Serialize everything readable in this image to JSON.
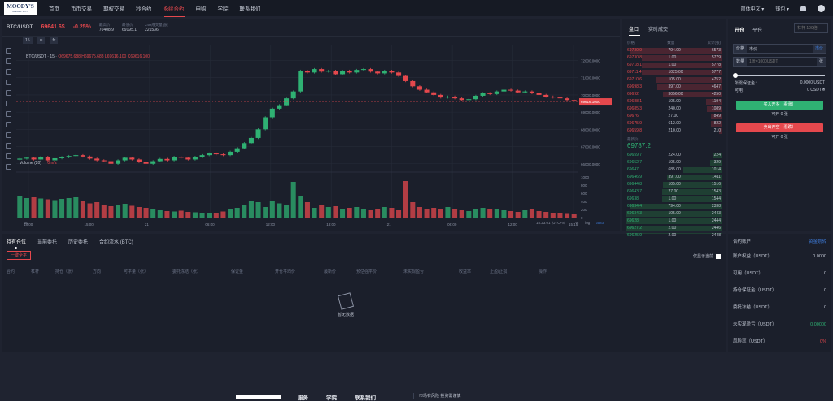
{
  "logo": {
    "line1": "MOODY'S",
    "line2": "ANALYTICS"
  },
  "nav": {
    "items": [
      "首页",
      "币币交易",
      "期权交易",
      "秒合约",
      "永续合约",
      "申购",
      "学院",
      "联系我们"
    ],
    "active_index": 4,
    "language": "简体中文 ▾",
    "wallet": "钱包 ▾"
  },
  "ticker": {
    "symbol": "BTC/USDT",
    "price": "69641.6$",
    "change": "-0.25%",
    "stats": [
      {
        "label": "最高价",
        "value": "70408.9"
      },
      {
        "label": "最低价",
        "value": "69195.1"
      },
      {
        "label": "24H成交量(张)",
        "value": "221536"
      }
    ]
  },
  "chart_toolbar": {
    "interval": "15",
    "candles_label": "ılı",
    "indicators": "fx"
  },
  "chart_legend": {
    "pair": "BTC/USDT · 15 ·",
    "ohlc": "O69675.688 H69675.688 L69616.100 C69616.100"
  },
  "volume_legend": {
    "label": "Volume (20)",
    "value": "0 n/a"
  },
  "time_bar": {
    "range_label": "5d",
    "clock": "15:23:01 (UTC+8)",
    "scale": "%",
    "log": "log",
    "auto": "auto"
  },
  "chart_data": {
    "type": "candlestick",
    "price_axis": [
      "72000.0000",
      "71000.0000",
      "70000.0000",
      "69000.0000",
      "68000.0000",
      "67000.0000",
      "66000.0000"
    ],
    "volume_axis": [
      "1000",
      "800",
      "600",
      "400",
      "200",
      "0"
    ],
    "time_axis": [
      "18:00",
      "15:00",
      "21",
      "06:00",
      "12:00",
      "18:00",
      "21",
      "06:00",
      "12:00",
      "15:15"
    ],
    "last_price_tag": "69616.1000",
    "ylim": [
      65800,
      72400
    ],
    "series": [
      66300,
      66350,
      66250,
      66400,
      66200,
      66320,
      66380,
      66450,
      66500,
      66420,
      66300,
      66200,
      66150,
      66000,
      66200,
      66350,
      66250,
      66100,
      66000,
      66150,
      66280,
      66200,
      66400,
      66350,
      66250,
      66400,
      66500,
      66600,
      66550,
      66500,
      66700,
      66900,
      67200,
      67500,
      68000,
      68700,
      69200,
      69400,
      69800,
      70200,
      71400,
      71300,
      71500,
      71350,
      71400,
      71200,
      71400,
      71300,
      71450,
      71500,
      71350,
      71250,
      71400,
      71300,
      71100,
      70800,
      70500,
      70300,
      70150,
      70000,
      69850,
      69900,
      69800,
      69700,
      69750,
      69950,
      70100,
      70050,
      70200,
      70300,
      70250,
      70150,
      70200,
      70100,
      70000,
      69900,
      69850,
      69800,
      69700,
      69616
    ],
    "volumes": [
      520,
      480,
      500,
      470,
      450,
      430,
      460,
      480,
      500,
      420,
      350,
      380,
      300,
      280,
      320,
      340,
      290,
      260,
      240,
      200,
      180,
      160,
      150,
      170,
      140,
      130,
      120,
      110,
      100,
      150,
      220,
      240,
      300,
      420,
      380,
      260,
      420,
      350,
      300,
      880,
      520,
      380,
      240,
      300,
      260,
      280,
      200,
      240,
      260,
      220,
      180,
      200,
      260,
      240,
      180,
      900,
      380,
      260,
      200,
      240,
      220,
      260,
      200,
      180,
      160,
      200,
      240,
      220,
      200,
      180,
      160,
      140,
      180,
      200,
      160,
      140,
      120,
      100,
      90,
      80
    ]
  },
  "orderbook": {
    "tabs": [
      "盘口",
      "实时成交"
    ],
    "headers": [
      "价格",
      "数量",
      "累计(张)"
    ],
    "asks": [
      {
        "price": "69730.9",
        "qty": "794.00",
        "total": "6573",
        "depth": 0.95
      },
      {
        "price": "69730.8",
        "qty": "1.00",
        "total": "5779",
        "depth": 0.83
      },
      {
        "price": "69718.1",
        "qty": "1.00",
        "total": "5778",
        "depth": 0.83
      },
      {
        "price": "69711.4",
        "qty": "1025.00",
        "total": "5777",
        "depth": 0.83
      },
      {
        "price": "69710.6",
        "qty": "105.00",
        "total": "4752",
        "depth": 0.68
      },
      {
        "price": "69698.3",
        "qty": "397.00",
        "total": "4647",
        "depth": 0.67
      },
      {
        "price": "69692",
        "qty": "3056.00",
        "total": "4250",
        "depth": 0.61
      },
      {
        "price": "69688.1",
        "qty": "105.00",
        "total": "1194",
        "depth": 0.17
      },
      {
        "price": "69685.3",
        "qty": "240.00",
        "total": "1089",
        "depth": 0.16
      },
      {
        "price": "69676",
        "qty": "27.00",
        "total": "849",
        "depth": 0.12
      },
      {
        "price": "69675.9",
        "qty": "612.00",
        "total": "822",
        "depth": 0.12
      },
      {
        "price": "69659.8",
        "qty": "210.00",
        "total": "210",
        "depth": 0.03
      }
    ],
    "last_label": "最新价",
    "last_price": "69787.2",
    "bids": [
      {
        "price": "69659.7",
        "qty": "224.00",
        "total": "224",
        "depth": 0.09
      },
      {
        "price": "69652.7",
        "qty": "105.00",
        "total": "329",
        "depth": 0.13
      },
      {
        "price": "69647",
        "qty": "685.00",
        "total": "1014",
        "depth": 0.41
      },
      {
        "price": "69646.9",
        "qty": "397.00",
        "total": "1411",
        "depth": 0.57
      },
      {
        "price": "69644.8",
        "qty": "105.00",
        "total": "1516",
        "depth": 0.61
      },
      {
        "price": "69643.7",
        "qty": "27.00",
        "total": "1543",
        "depth": 0.62
      },
      {
        "price": "69638",
        "qty": "1.00",
        "total": "1544",
        "depth": 0.62
      },
      {
        "price": "69634.4",
        "qty": "794.00",
        "total": "2338",
        "depth": 0.95
      },
      {
        "price": "69634.3",
        "qty": "105.00",
        "total": "2443",
        "depth": 0.99
      },
      {
        "price": "69628",
        "qty": "1.00",
        "total": "2444",
        "depth": 0.99
      },
      {
        "price": "69627.2",
        "qty": "2.00",
        "total": "2446",
        "depth": 0.99
      },
      {
        "price": "69625.9",
        "qty": "2.00",
        "total": "2448",
        "depth": 0.99
      }
    ]
  },
  "order_form": {
    "tabs": [
      "开仓",
      "平仓"
    ],
    "leverage_placeholder": "杠杆 100倍",
    "price_label": "价格",
    "price_value": "市价",
    "price_unit": "市价",
    "qty_label": "数量",
    "qty_placeholder": "1张=1000USDT",
    "qty_unit": "张",
    "slider_value": 0,
    "margin_label": "所需保证金：",
    "margin_value": "0.0000 USDT",
    "available_label": "可用：",
    "available_value": "0 USDT ₴",
    "buy_label": "买入开多（看涨）",
    "buy_avail": "可开 0 张",
    "sell_label": "卖出开空（看跌）",
    "sell_avail": "可开 0 张"
  },
  "positions": {
    "tabs": [
      "持有仓位",
      "当前委托",
      "历史委托",
      "合约流水 (BTC)"
    ],
    "close_all": "一键全平",
    "only_current": "仅显示当前",
    "columns": [
      "合约",
      "杠杆",
      "持仓（张）",
      "方向",
      "可平量（张）",
      "委托冻结（张）",
      "保证金",
      "开仓平均价",
      "最新价",
      "预估强平价",
      "未实现盈亏",
      "收益率",
      "止盈/止损",
      "操作"
    ],
    "empty_text": "暂无数据"
  },
  "account": {
    "title": "合约账户",
    "link": "资金划转",
    "rows": [
      {
        "label": "账户权益（USDT）",
        "value": "0.0000",
        "tone": ""
      },
      {
        "label": "可用（USDT）",
        "value": "0",
        "tone": ""
      },
      {
        "label": "持仓保证金（USDT）",
        "value": "0",
        "tone": ""
      },
      {
        "label": "委托冻结（USDT）",
        "value": "0",
        "tone": ""
      },
      {
        "label": "未实现盈亏（USDT）",
        "value": "0.00000",
        "tone": "g"
      },
      {
        "label": "风险率（USDT）",
        "value": "0%",
        "tone": "r"
      }
    ]
  },
  "footer": {
    "links": [
      "服务",
      "学院",
      "联系我们"
    ],
    "risk": "市场有风险 投资需谨慎"
  }
}
